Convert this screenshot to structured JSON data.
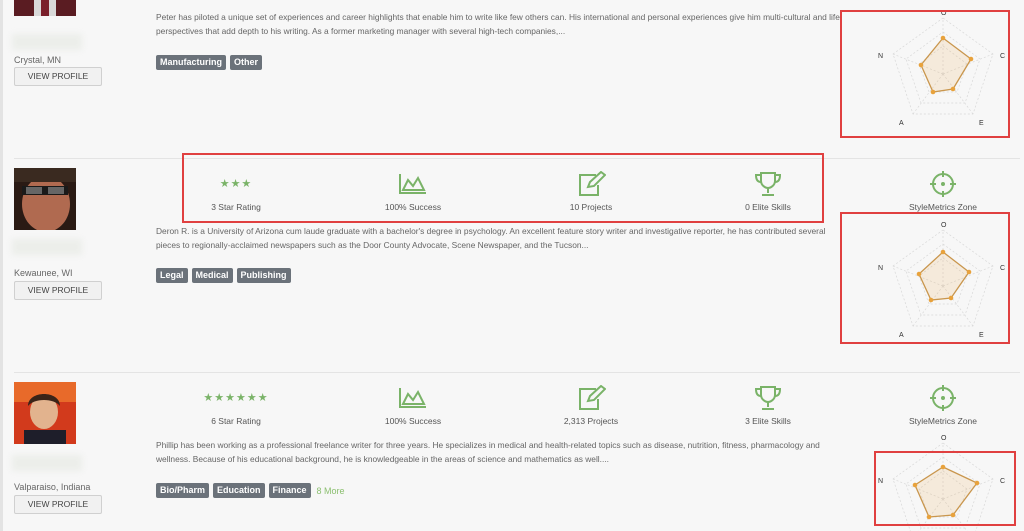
{
  "profiles": [
    {
      "location": "Crystal, MN",
      "view_label": "VIEW PROFILE",
      "bio": "Peter has piloted a unique set of experiences and career highlights that enable him to write like few others can. His international and personal experiences give him multi-cultural and life perspectives that add depth to his writing. As a former marketing manager with several high-tech companies,...",
      "tags": [
        "Manufacturing",
        "Other"
      ],
      "radar_labels": {
        "top": "O",
        "right": "C",
        "bottom_right": "E",
        "bottom_left": "A",
        "left": "N"
      }
    },
    {
      "location": "Kewaunee, WI",
      "view_label": "VIEW PROFILE",
      "stats": {
        "rating": "3 Star Rating",
        "stars": "★★★",
        "success": "100% Success",
        "projects": "10 Projects",
        "elite": "0 Elite Skills",
        "zone": "StyleMetrics Zone"
      },
      "bio": "Deron R. is a University of Arizona cum laude graduate with a bachelor's degree in psychology. An excellent feature story writer and investigative reporter, he has contributed several pieces to regionally-acclaimed newspapers such as the Door County Advocate, Scene Newspaper, and the Tucson...",
      "tags": [
        "Legal",
        "Medical",
        "Publishing"
      ],
      "radar_labels": {
        "top": "O",
        "right": "C",
        "bottom_right": "E",
        "bottom_left": "A",
        "left": "N"
      }
    },
    {
      "location": "Valparaiso, Indiana",
      "view_label": "VIEW PROFILE",
      "stats": {
        "rating": "6 Star Rating",
        "stars": "★★★★★★",
        "success": "100% Success",
        "projects": "2,313 Projects",
        "elite": "3 Elite Skills",
        "zone": "StyleMetrics Zone"
      },
      "bio": "Phillip has been working as a professional freelance writer for three years. He specializes in medical and health-related topics such as disease, nutrition, fitness, pharmacology and wellness. Because of his educational background, he is knowledgeable in the areas of science and mathematics as well....",
      "tags": [
        "Bio/Pharm",
        "Education",
        "Finance"
      ],
      "more": "8 More",
      "radar_labels": {
        "top": "O",
        "right": "C",
        "bottom_right": "",
        "bottom_left": "",
        "left": "N"
      }
    }
  ],
  "colors": {
    "accent_green": "#7ab368",
    "highlight_red": "#e04040",
    "radar_orange": "#e8a23c"
  }
}
